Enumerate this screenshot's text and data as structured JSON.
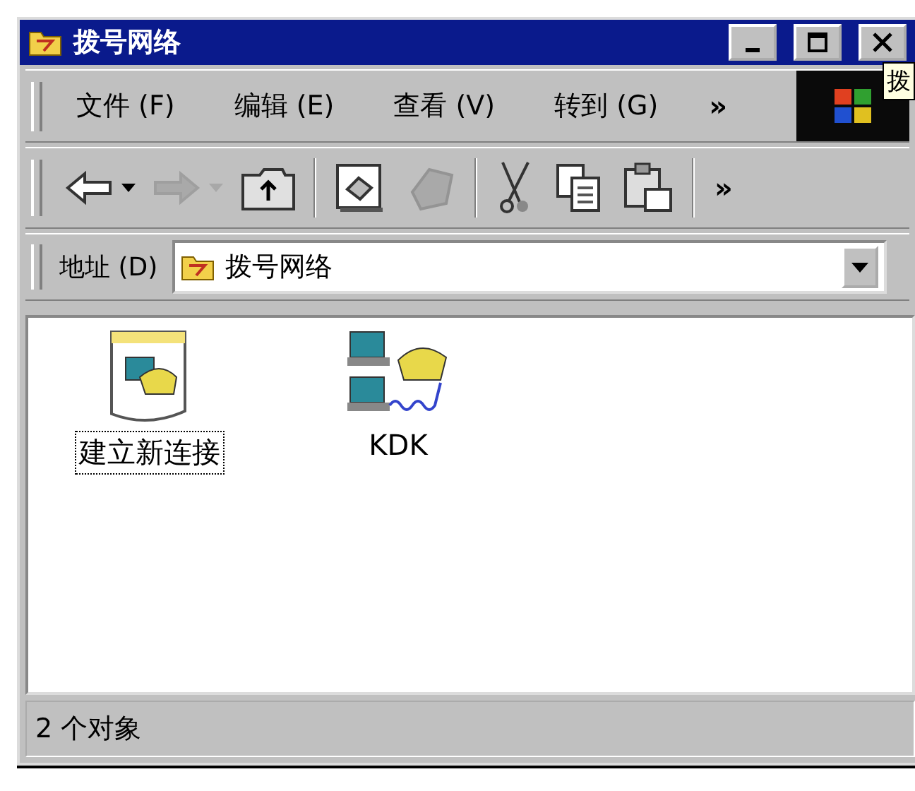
{
  "window": {
    "title": "拨号网络"
  },
  "tooltip": "拨",
  "menu": [
    {
      "label": "文件 (F)"
    },
    {
      "label": "编辑 (E)"
    },
    {
      "label": "查看 (V)"
    },
    {
      "label": "转到 (G)"
    }
  ],
  "menu_more": "»",
  "toolbar": [
    {
      "kind": "back",
      "disabled": false,
      "dropdown": true
    },
    {
      "kind": "forward",
      "disabled": true,
      "dropdown": true
    },
    {
      "kind": "up",
      "disabled": false,
      "dropdown": false
    },
    {
      "kind": "sep"
    },
    {
      "kind": "map-drive",
      "disabled": false,
      "dropdown": false
    },
    {
      "kind": "disconnect",
      "disabled": true,
      "dropdown": false
    },
    {
      "kind": "sep"
    },
    {
      "kind": "cut",
      "disabled": false,
      "dropdown": false
    },
    {
      "kind": "copy",
      "disabled": false,
      "dropdown": false
    },
    {
      "kind": "paste",
      "disabled": false,
      "dropdown": false
    },
    {
      "kind": "sep"
    }
  ],
  "toolbar_more": "»",
  "address": {
    "label": "地址 (D)",
    "value": "拨号网络"
  },
  "items": [
    {
      "label": "建立新连接",
      "kind": "wizard",
      "selected": true
    },
    {
      "label": "KDK",
      "kind": "connection",
      "selected": false
    }
  ],
  "status_bar": "2 个对象"
}
